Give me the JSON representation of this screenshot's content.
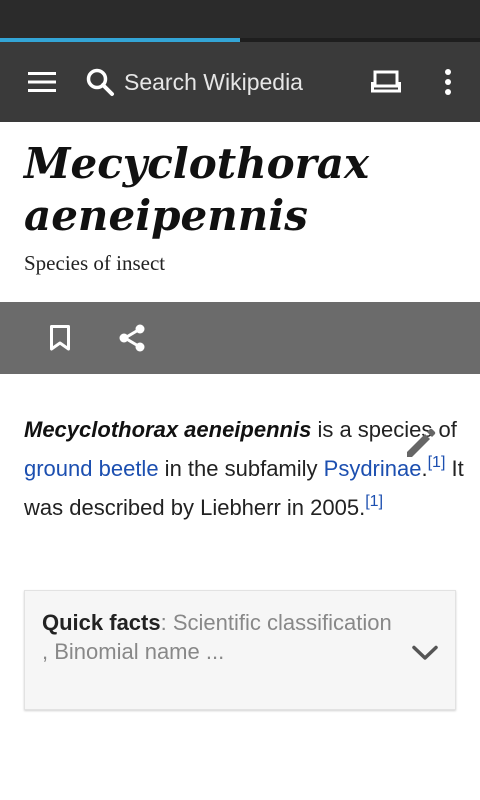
{
  "toolbar": {
    "search_label": "Search Wikipedia",
    "icons": [
      "menu-icon",
      "search-icon",
      "tabs-icon",
      "overflow-menu-icon"
    ]
  },
  "page_load_progress": 0.5,
  "article": {
    "title": "Mecyclothorax aeneipennis",
    "description": "Species of insect",
    "actions": [
      "bookmark-icon",
      "share-icon"
    ],
    "lead": {
      "bold_term": "Mecyclothorax aeneipennis",
      "text_1": " is a species of ",
      "link_1": "ground beetle",
      "text_2": " in the subfamily ",
      "link_2": "Psydrinae",
      "text_3": ".",
      "ref_1": "[1]",
      "text_4": " It was described by Liebherr in 2005.",
      "ref_2": "[1]"
    },
    "quick_facts": {
      "heading": "Quick facts",
      "summary": ": Scientific classification , Binomial name ..."
    }
  },
  "colors": {
    "status_bar": "#2b2b2b",
    "toolbar": "#3a3a3a",
    "progress": "#33a5d6",
    "action_bar": "#6b6b6b",
    "link": "#1c4fb0"
  }
}
